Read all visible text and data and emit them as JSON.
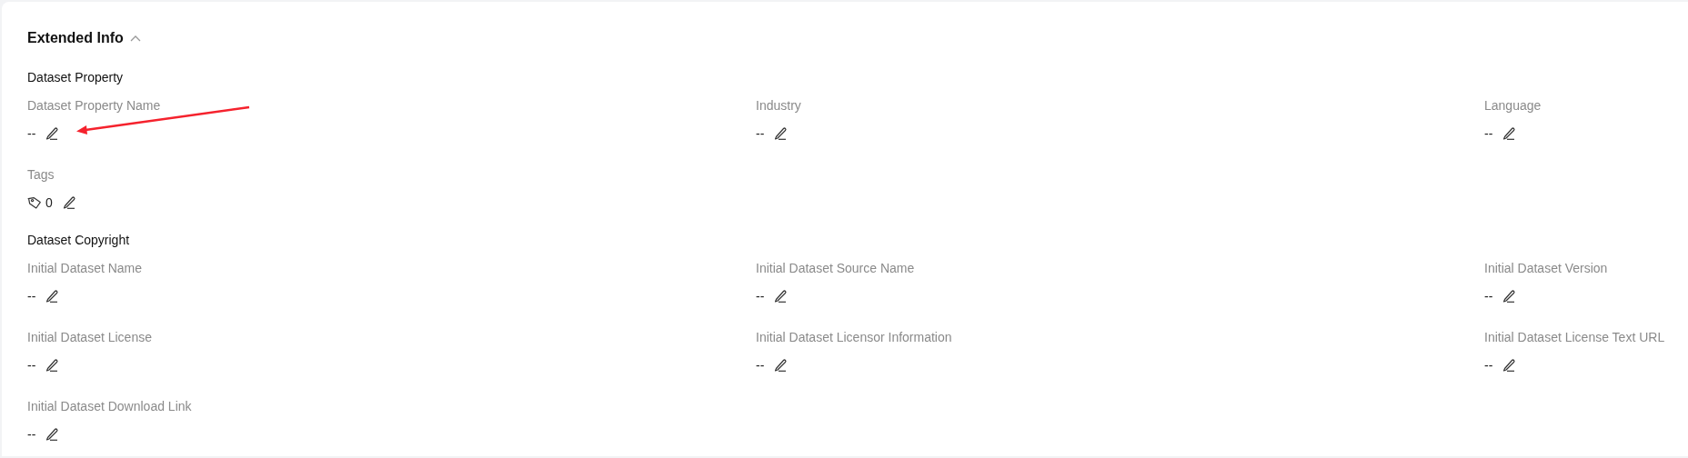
{
  "card": {
    "title": "Extended Info",
    "expanded": true
  },
  "sections": [
    {
      "title": "Dataset Property",
      "fields": [
        {
          "kind": "text",
          "label": "Dataset Property Name",
          "value": "--"
        },
        {
          "kind": "text",
          "label": "Industry",
          "value": "--"
        },
        {
          "kind": "text",
          "label": "Language",
          "value": "--"
        },
        {
          "kind": "tags",
          "label": "Tags",
          "value": "0"
        }
      ]
    },
    {
      "title": "Dataset Copyright",
      "fields": [
        {
          "kind": "text",
          "label": "Initial Dataset Name",
          "value": "--"
        },
        {
          "kind": "text",
          "label": "Initial Dataset Source Name",
          "value": "--"
        },
        {
          "kind": "text",
          "label": "Initial Dataset Version",
          "value": "--"
        },
        {
          "kind": "text",
          "label": "Initial Dataset License",
          "value": "--"
        },
        {
          "kind": "text",
          "label": "Initial Dataset Licensor Information",
          "value": "--"
        },
        {
          "kind": "text",
          "label": "Initial Dataset License Text URL",
          "value": "--"
        },
        {
          "kind": "text",
          "label": "Initial Dataset Download Link",
          "value": "--"
        }
      ]
    }
  ],
  "annotations": [
    {
      "kind": "arrow"
    }
  ]
}
